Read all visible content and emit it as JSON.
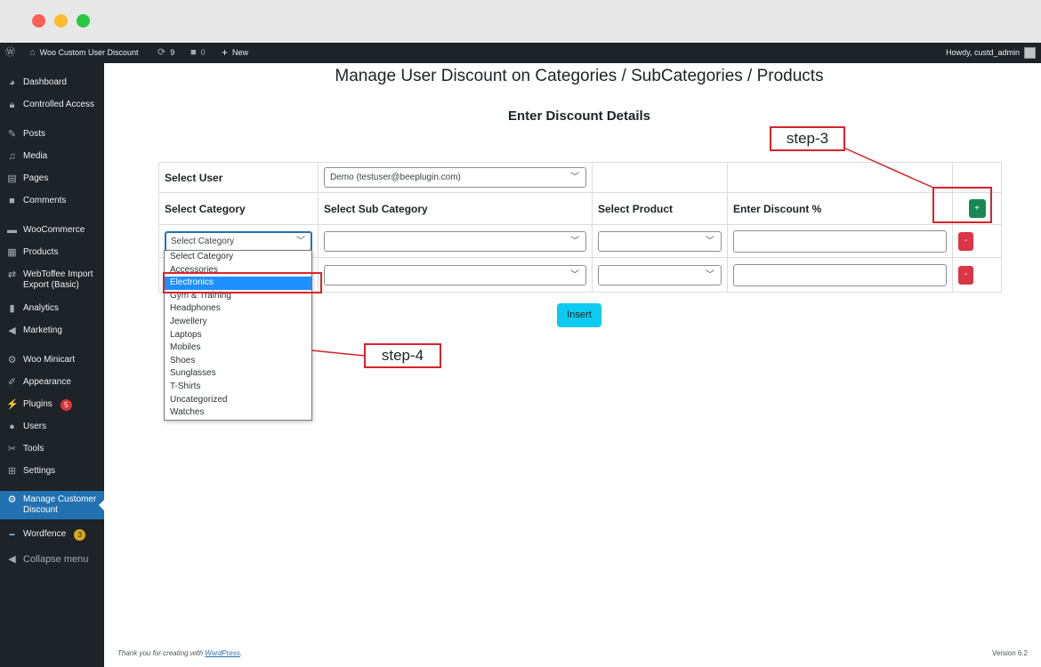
{
  "adminbar": {
    "site_name": "Woo Custom User Discount",
    "updates_count": "9",
    "comments_count": "0",
    "new_label": "New",
    "howdy": "Howdy, custd_admin"
  },
  "sidebar": {
    "items": [
      {
        "label": "Dashboard",
        "icon": "dashboard-icon"
      },
      {
        "label": "Controlled Access",
        "icon": "lock-icon"
      },
      {
        "label": "Posts",
        "icon": "pin-icon"
      },
      {
        "label": "Media",
        "icon": "media-icon"
      },
      {
        "label": "Pages",
        "icon": "pages-icon"
      },
      {
        "label": "Comments",
        "icon": "comment-icon"
      },
      {
        "label": "WooCommerce",
        "icon": "woo-icon"
      },
      {
        "label": "Products",
        "icon": "archive-icon"
      },
      {
        "label": "WebToffee Import Export (Basic)",
        "icon": "import-export-icon"
      },
      {
        "label": "Analytics",
        "icon": "chart-icon"
      },
      {
        "label": "Marketing",
        "icon": "megaphone-icon"
      },
      {
        "label": "Woo Minicart",
        "icon": "gear-icon"
      },
      {
        "label": "Appearance",
        "icon": "brush-icon"
      },
      {
        "label": "Plugins",
        "icon": "plug-icon",
        "badge": "5"
      },
      {
        "label": "Users",
        "icon": "user-icon"
      },
      {
        "label": "Tools",
        "icon": "wrench-icon"
      },
      {
        "label": "Settings",
        "icon": "settings-icon"
      },
      {
        "label": "Manage Customer Discount",
        "icon": "gear-icon"
      },
      {
        "label": "Wordfence",
        "icon": "wordfence-icon",
        "badge": "3"
      }
    ],
    "collapse_label": "Collapse menu"
  },
  "main": {
    "title": "Manage User Discount on Categories / SubCategories / Products",
    "subtitle": "Enter Discount Details",
    "select_user_label": "Select User",
    "select_user_value": "Demo (testuser@beeplugin.com)",
    "headers": {
      "category": "Select Category",
      "subcategory": "Select Sub Category",
      "product": "Select Product",
      "discount": "Enter Discount %"
    },
    "row1_category_value": "Select Category",
    "add_button": "+",
    "remove_button": "-",
    "insert_button": "Insert"
  },
  "dropdown": {
    "options": [
      "Select Category",
      "Accessories",
      "Electronics",
      "Gym & Training",
      "Headphones",
      "Jewellery",
      "Laptops",
      "Mobiles",
      "Shoes",
      "Sunglasses",
      "T-Shirts",
      "Uncategorized",
      "Watches"
    ],
    "selected": "Electronics"
  },
  "annotations": {
    "step3": "step-3",
    "step4": "step-4",
    "color": "#d8232a"
  },
  "footer": {
    "thanks_prefix": "Thank you for creating with ",
    "thanks_link": "WordPress",
    "thanks_suffix": ".",
    "version": "Version 6.2"
  }
}
